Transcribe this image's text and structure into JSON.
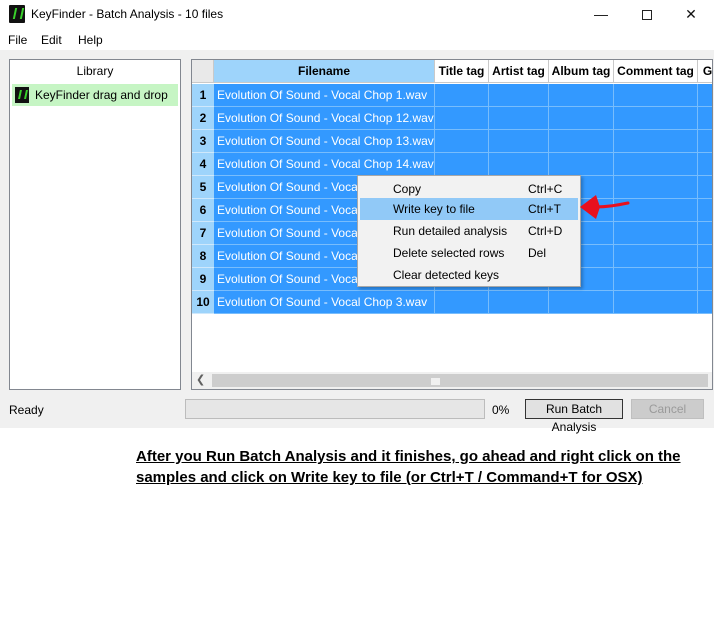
{
  "window": {
    "title": "KeyFinder - Batch Analysis - 10 files",
    "minimize_glyph": "—",
    "close_glyph": "✕"
  },
  "menu": [
    "File",
    "Edit",
    "Help"
  ],
  "library": {
    "header": "Library",
    "items": [
      {
        "label": "KeyFinder drag and drop",
        "icon": "keyfinder-logo-icon"
      }
    ]
  },
  "table": {
    "columns": [
      "Filename",
      "Title tag",
      "Artist tag",
      "Album tag",
      "Comment tag",
      "G"
    ],
    "rows": [
      {
        "num": "1",
        "filename": "Evolution Of Sound - Vocal Chop 1.wav"
      },
      {
        "num": "2",
        "filename": "Evolution Of Sound - Vocal Chop 12.wav"
      },
      {
        "num": "3",
        "filename": "Evolution Of Sound - Vocal Chop 13.wav"
      },
      {
        "num": "4",
        "filename": "Evolution Of Sound - Vocal Chop 14.wav"
      },
      {
        "num": "5",
        "filename": "Evolution Of Sound - Vocal Chop 15.wav"
      },
      {
        "num": "6",
        "filename": "Evolution Of Sound - Vocal Chop 16.wav"
      },
      {
        "num": "7",
        "filename": "Evolution Of Sound - Vocal Chop 17.wav"
      },
      {
        "num": "8",
        "filename": "Evolution Of Sound - Vocal Chop 18.wav"
      },
      {
        "num": "9",
        "filename": "Evolution Of Sound - Vocal Chop 19.wav"
      },
      {
        "num": "10",
        "filename": "Evolution Of Sound - Vocal Chop 3.wav"
      }
    ]
  },
  "context_menu": {
    "items": [
      {
        "label": "Copy",
        "shortcut": "Ctrl+C"
      },
      {
        "label": "Write key to file",
        "shortcut": "Ctrl+T",
        "highlighted": true
      },
      {
        "label": "Run detailed analysis",
        "shortcut": "Ctrl+D"
      },
      {
        "label": "Delete selected rows",
        "shortcut": "Del"
      },
      {
        "label": "Clear detected keys",
        "shortcut": ""
      }
    ]
  },
  "status": {
    "text": "Ready",
    "progress": 0,
    "progress_label": "0%",
    "run_button": "Run Batch Analysis",
    "cancel_button": "Cancel"
  },
  "annotation": {
    "arrow_color": "#e8101e",
    "text": "After you Run Batch Analysis and it finishes, go ahead and right click on the samples and click on Write key to file (or Ctrl+T / Command+T for OSX)"
  },
  "colors": {
    "selection": "#3399ff",
    "header_selected": "#9ed4fb",
    "library_item": "#c6f5c4",
    "menu_highlight": "#91c9f7"
  }
}
